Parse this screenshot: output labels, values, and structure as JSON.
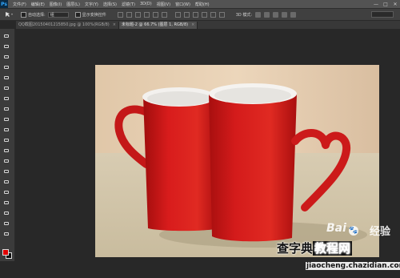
{
  "app": {
    "logo": "Ps",
    "menus": [
      "文件(F)",
      "编辑(E)",
      "图像(I)",
      "图层(L)",
      "文字(Y)",
      "选择(S)",
      "滤镜(T)",
      "3D(D)",
      "视图(V)",
      "窗口(W)",
      "帮助(H)"
    ],
    "window_controls": [
      "—",
      "□",
      "✕"
    ]
  },
  "options": {
    "auto_select_label": "自动选择:",
    "auto_select_value": "组",
    "show_transform_label": "显示变换控件",
    "mode_label": "3D 模式:",
    "workspace_value": ""
  },
  "tabs": [
    {
      "label": "QQ截图20150401215850.jpg @ 100%(RGB/8)",
      "active": false,
      "close": "×"
    },
    {
      "label": "未标题-2 @ 66.7% (图层 1, RGB/8)",
      "active": true,
      "close": "×"
    }
  ],
  "tools": [
    "move-tool",
    "marquee-tool",
    "lasso-tool",
    "quick-select-tool",
    "crop-tool",
    "eyedropper-tool",
    "healing-brush-tool",
    "brush-tool",
    "clone-stamp-tool",
    "history-brush-tool",
    "eraser-tool",
    "gradient-tool",
    "blur-tool",
    "dodge-tool",
    "pen-tool",
    "type-tool",
    "path-select-tool",
    "shape-tool",
    "hand-tool",
    "zoom-tool"
  ],
  "colors": {
    "foreground": "#e00000",
    "background": "#111111",
    "mug_red": "#d81c1c"
  },
  "watermark": {
    "baidu": "Bai",
    "paw": "🐾",
    "jingyan": "经验",
    "site_prefix": "查字典",
    "site_boxed": "教程网",
    "url": "jiaocheng.chazidian.com"
  }
}
